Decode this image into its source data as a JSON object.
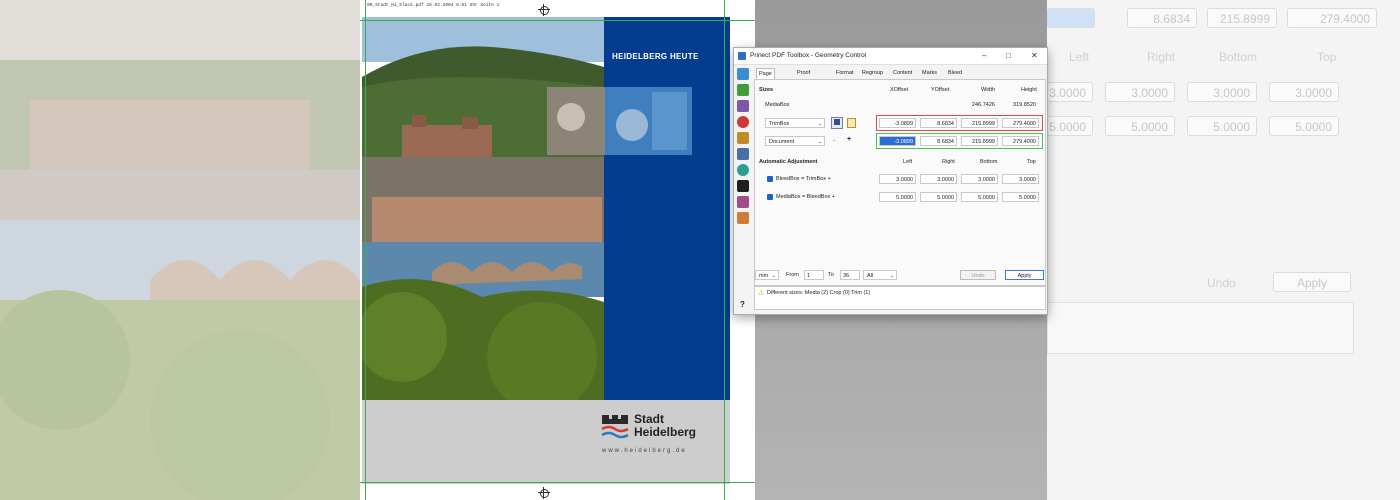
{
  "document": {
    "header_line": "00_Stadt_Hi_black.pdf   26.02.2004  8:51 Uhr  Seite 1",
    "cover_title": "HEIDELBERG HEUTE",
    "logo_line1": "Stadt",
    "logo_line2": "Heidelberg",
    "website": "www.heidelberg.de"
  },
  "dialog": {
    "title": "Prinect PDF Toolbox - Geometry Control",
    "tabs": [
      "Page Sizes",
      "Proof Color",
      "Format",
      "Regroup",
      "Content",
      "Marks",
      "Bleed"
    ],
    "sizes_heading": "Sizes",
    "columns": [
      "XOffset",
      "YOffset",
      "Width",
      "Height"
    ],
    "mediabox": {
      "label": "MediaBox",
      "width": "246.7426",
      "height": "319.8520"
    },
    "trimbox": {
      "select": "TrimBox",
      "xoffset": "-3.0899",
      "yoffset": "8.6834",
      "width": "215.8999",
      "height": "279.4000"
    },
    "document_row": {
      "select": "Document",
      "xoffset": "-3.0899",
      "yoffset": "8.6834",
      "width": "215.8999",
      "height": "279.4000"
    },
    "auto_heading": "Automatic Adjustment",
    "auto_columns": [
      "Left",
      "Right",
      "Bottom",
      "Top"
    ],
    "bleed_trim": {
      "label": "BleedBox = TrimBox +",
      "left": "3.0000",
      "right": "3.0000",
      "bottom": "3.0000",
      "top": "3.0000"
    },
    "media_bleed": {
      "label": "MediaBox = BleedBox +",
      "left": "5.0000",
      "right": "5.0000",
      "bottom": "5.0000",
      "top": "5.0000"
    },
    "unit": "mm",
    "from_label": "From",
    "from_value": "1",
    "to_label": "To",
    "to_value": "36",
    "range": "All",
    "undo": "Undo",
    "apply": "Apply",
    "help": "?",
    "status": "Different sizes: Media (2) Crop (0) Trim (1)"
  },
  "ghost": {
    "top_values": [
      "8.6834",
      "215.8999",
      "279.4000"
    ],
    "columns": [
      "Left",
      "Right",
      "Bottom",
      "Top"
    ],
    "row1": [
      "3.0000",
      "3.0000",
      "3.0000",
      "3.0000"
    ],
    "row2": [
      "5.0000",
      "5.0000",
      "5.0000",
      "5.0000"
    ],
    "undo": "Undo",
    "apply": "Apply"
  }
}
